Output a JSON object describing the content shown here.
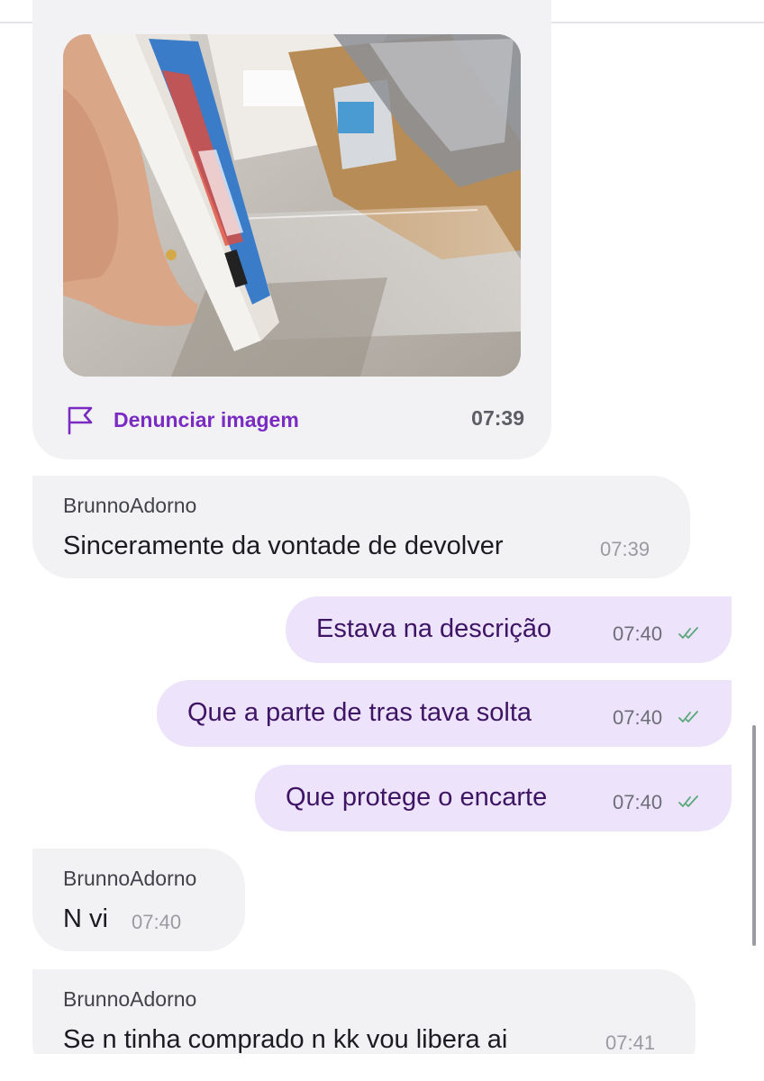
{
  "image_message": {
    "report_label": "Denunciar imagem",
    "time": "07:39",
    "photo_alt": "Foto de um jogo com a capa plástica solta"
  },
  "messages": [
    {
      "direction": "incoming",
      "sender": "BrunnoAdorno",
      "text": "Sinceramente da vontade de devolver",
      "time": "07:39"
    },
    {
      "direction": "outgoing",
      "text": "Estava na descrição",
      "time": "07:40",
      "status": "read"
    },
    {
      "direction": "outgoing",
      "text": "Que a parte de tras tava solta",
      "time": "07:40",
      "status": "read"
    },
    {
      "direction": "outgoing",
      "text": "Que protege o encarte",
      "time": "07:40",
      "status": "read"
    },
    {
      "direction": "incoming",
      "sender": "BrunnoAdorno",
      "text": "N vi",
      "time": "07:40"
    },
    {
      "direction": "incoming",
      "sender": "BrunnoAdorno",
      "text": "Se n tinha comprado n kk vou libera ai",
      "time": "07:41"
    }
  ],
  "colors": {
    "incoming_bubble": "#f2f2f5",
    "outgoing_bubble": "#ede3fb",
    "outgoing_text": "#3e1565",
    "accent": "#7a2bc2",
    "read_tick": "#58a87a"
  },
  "icons": {
    "report": "flag-icon",
    "read_status": "double-check-icon"
  }
}
